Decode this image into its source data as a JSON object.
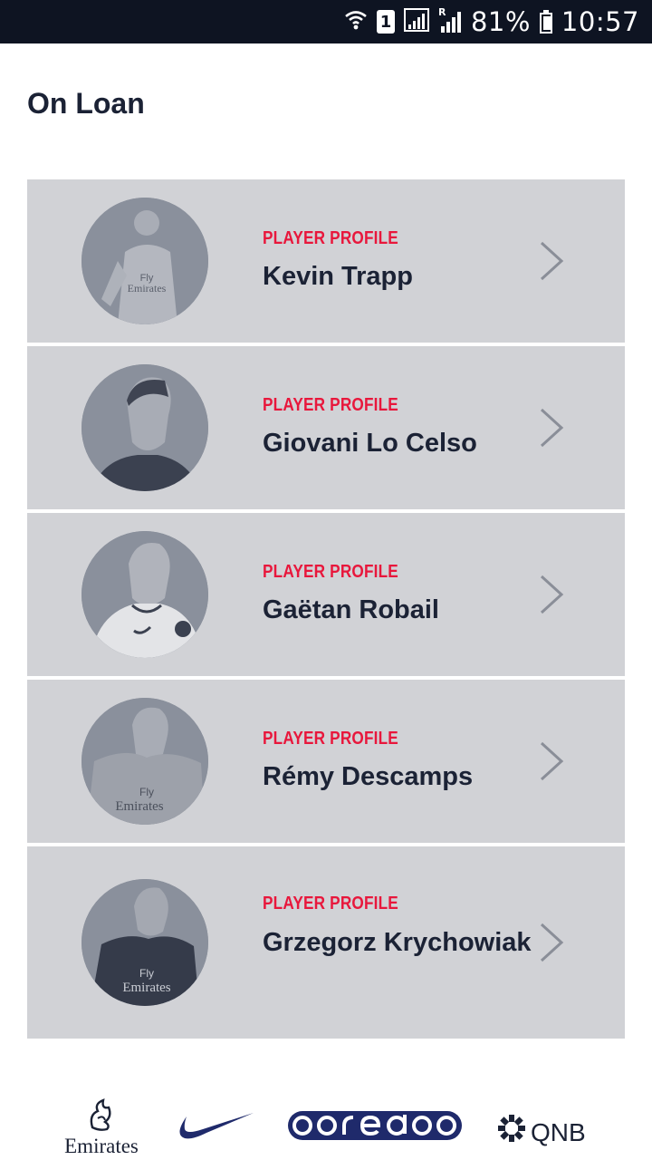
{
  "status_bar": {
    "sim_slot": "1",
    "roaming": "R",
    "battery_percent": "81%",
    "battery_level": 0.81,
    "time": "10:57",
    "icons": [
      "wifi-icon",
      "sim-badge-icon",
      "signal-icon",
      "roaming-signal-icon",
      "battery-icon"
    ]
  },
  "page": {
    "title": "On Loan"
  },
  "players": [
    {
      "kicker": "PLAYER PROFILE",
      "name": "Kevin Trapp",
      "avatar": "player-photo-avatar",
      "chevron": "chevron-right-icon"
    },
    {
      "kicker": "PLAYER PROFILE",
      "name": "Giovani Lo Celso",
      "avatar": "player-photo-avatar",
      "chevron": "chevron-right-icon"
    },
    {
      "kicker": "PLAYER PROFILE",
      "name": "Gaëtan Robail",
      "avatar": "player-photo-avatar",
      "chevron": "chevron-right-icon"
    },
    {
      "kicker": "PLAYER PROFILE",
      "name": "Rémy Descamps",
      "avatar": "player-photo-avatar",
      "chevron": "chevron-right-icon"
    },
    {
      "kicker": "PLAYER PROFILE",
      "name": "Grzegorz Krychowiak",
      "avatar": "player-photo-avatar",
      "chevron": "chevron-right-icon"
    }
  ],
  "sponsors": [
    {
      "name": "Emirates",
      "label": "Emirates",
      "icon": "emirates-logo"
    },
    {
      "name": "Nike",
      "icon": "nike-swoosh-logo"
    },
    {
      "name": "ooredoo",
      "icon": "ooredoo-logo"
    },
    {
      "name": "QNB",
      "label": "QNB",
      "icon": "qnb-logo"
    }
  ],
  "colors": {
    "status_bar_bg": "#0e1422",
    "row_bg": "#d1d2d6",
    "kicker": "#e8173c",
    "text_dark": "#1b2235",
    "chevron": "#8a8e98",
    "sponsor_navy": "#1f2a6b"
  }
}
